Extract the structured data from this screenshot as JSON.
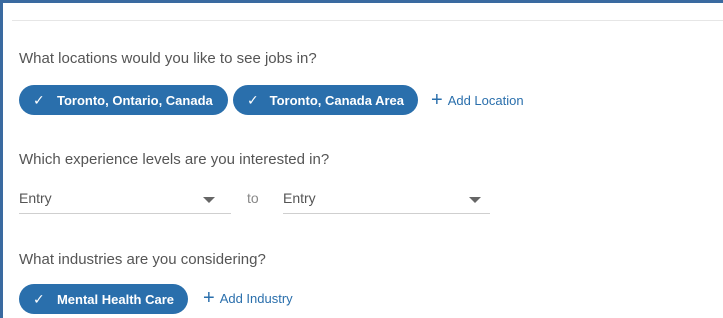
{
  "locations": {
    "question": "What locations would you like to see jobs in?",
    "chips": [
      {
        "label": "Toronto, Ontario, Canada",
        "check": "✓"
      },
      {
        "label": "Toronto, Canada Area",
        "check": "✓"
      }
    ],
    "add_label": "Add Location",
    "add_icon": "+"
  },
  "experience": {
    "question": "Which experience levels are you interested in?",
    "from_value": "Entry",
    "to_label": "to",
    "to_value": "Entry"
  },
  "industries": {
    "question": "What industries are you considering?",
    "chips": [
      {
        "label": "Mental Health Care",
        "check": "✓"
      }
    ],
    "add_label": "Add Industry",
    "add_icon": "+"
  },
  "colors": {
    "accent": "#2a6fac",
    "frame": "#3a6aa0"
  }
}
